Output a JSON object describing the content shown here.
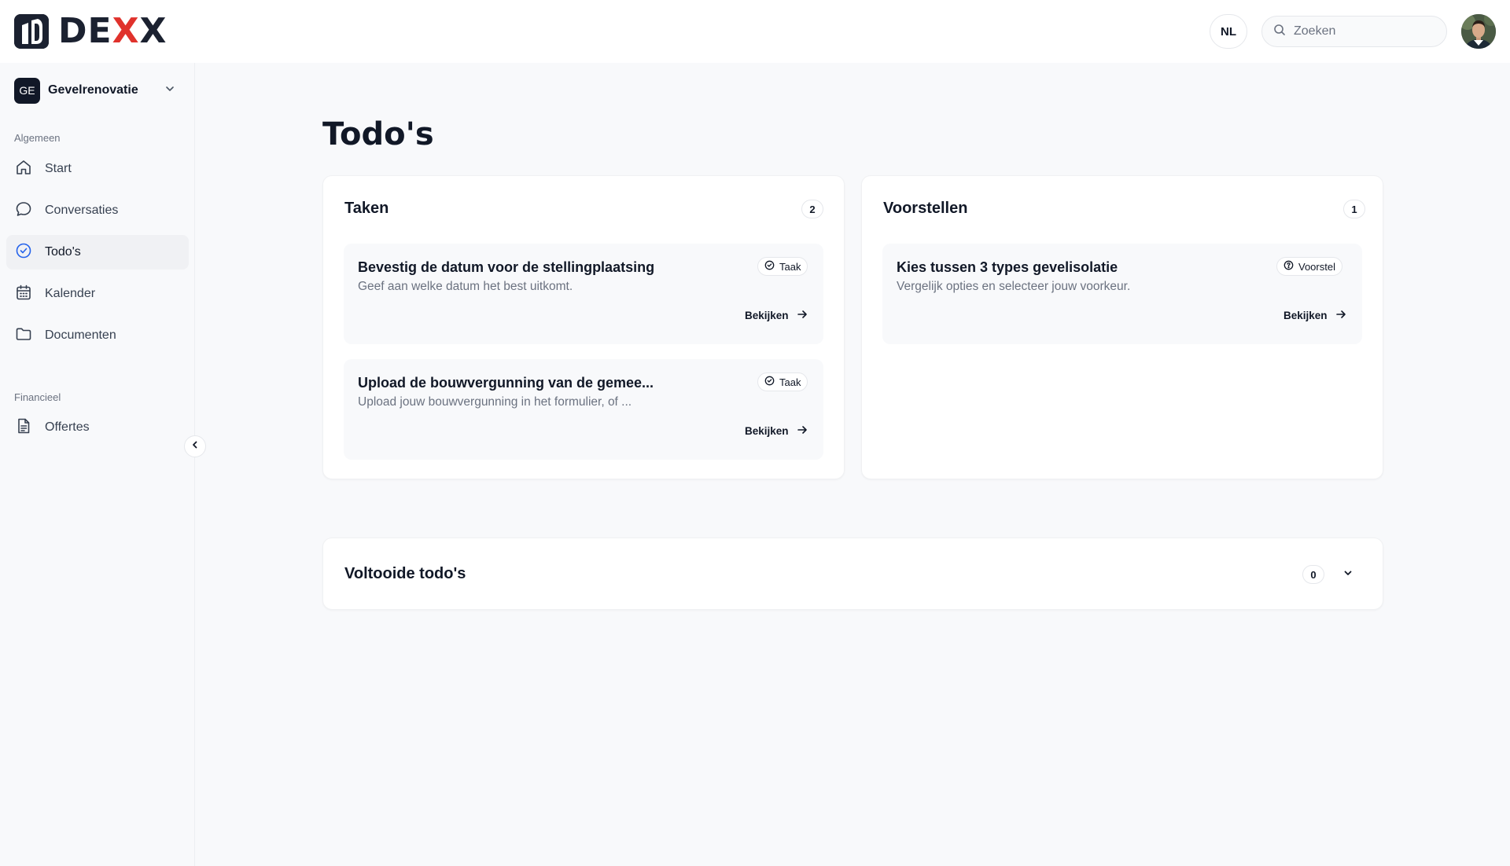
{
  "header": {
    "logo_text_prefix": "DE",
    "logo_text_x1": "X",
    "logo_text_x2": "X",
    "language": "NL",
    "search_placeholder": "Zoeken"
  },
  "sidebar": {
    "project": {
      "badge": "GE",
      "name": "Gevelrenovatie"
    },
    "sections": [
      {
        "label": "Algemeen",
        "items": [
          {
            "label": "Start",
            "icon": "home-icon"
          },
          {
            "label": "Conversaties",
            "icon": "chat-bubble-icon"
          },
          {
            "label": "Todo's",
            "icon": "check-circle-icon",
            "active": true
          },
          {
            "label": "Kalender",
            "icon": "calendar-icon"
          },
          {
            "label": "Documenten",
            "icon": "folder-icon"
          }
        ]
      },
      {
        "label": "Financieel",
        "items": [
          {
            "label": "Offertes",
            "icon": "document-icon"
          }
        ]
      }
    ]
  },
  "main": {
    "title": "Todo's",
    "tasks": {
      "title": "Taken",
      "count": "2",
      "items": [
        {
          "title": "Bevestig de datum voor de stellingplaatsing",
          "description": "Geef aan welke datum het best uitkomt.",
          "tag": "Taak",
          "action": "Bekijken"
        },
        {
          "title": "Upload de bouwvergunning van de gemee...",
          "description": "Upload jouw bouwvergunning in het formulier, of ...",
          "tag": "Taak",
          "action": "Bekijken"
        }
      ]
    },
    "proposals": {
      "title": "Voorstellen",
      "count": "1",
      "items": [
        {
          "title": "Kies tussen 3 types gevelisolatie",
          "description": "Vergelijk opties en selecteer jouw voorkeur.",
          "tag": "Voorstel",
          "action": "Bekijken"
        }
      ]
    },
    "completed": {
      "title": "Voltooide todo's",
      "count": "0"
    }
  },
  "colors": {
    "accent_red": "#e0322c",
    "brand_dark": "#1b2130",
    "active_icon_blue": "#2563eb"
  }
}
